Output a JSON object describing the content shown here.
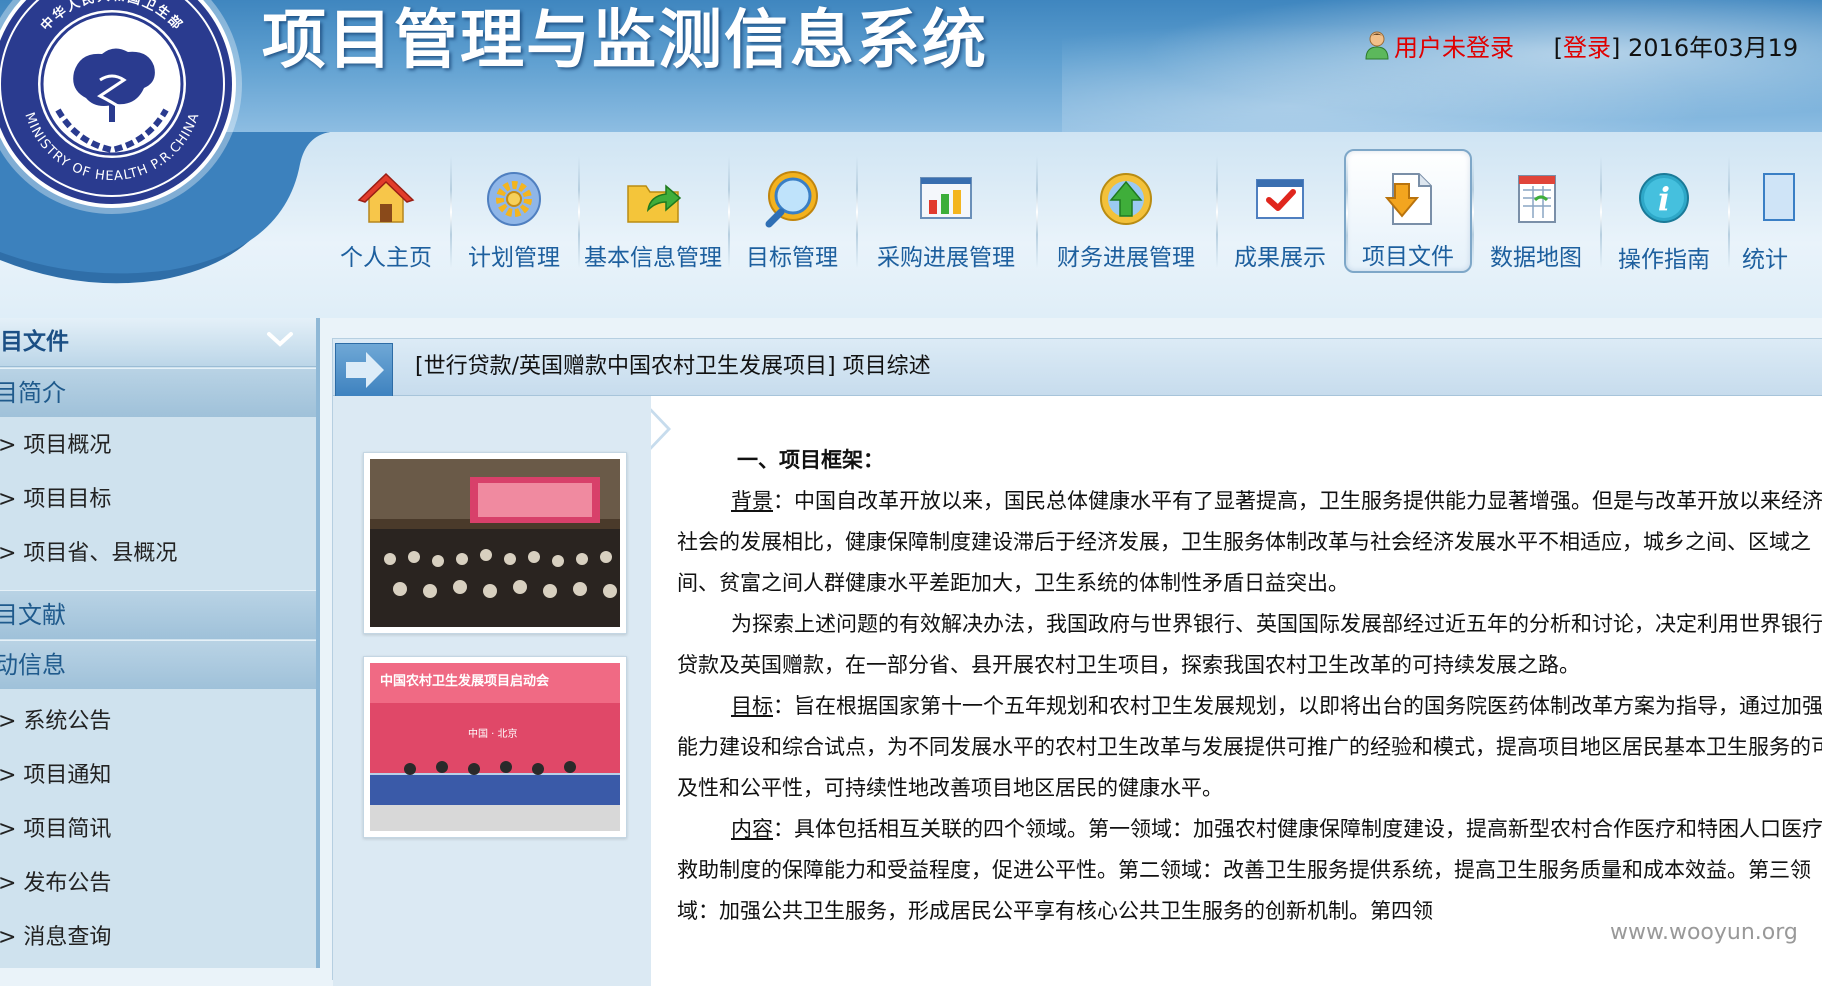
{
  "header": {
    "app_title": "项目管理与监测信息系统",
    "user_status": "用户未登录",
    "login_prefix": "[",
    "login_label": "登录",
    "login_suffix": "] 2016年03月19"
  },
  "logo": {
    "top_text": "中华人民共和国卫生部",
    "bottom_text": "MINISTRY OF HEALTH P.R.CHINA"
  },
  "nav": {
    "items": [
      {
        "label": "个人主页",
        "icon": "home-icon"
      },
      {
        "label": "计划管理",
        "icon": "gear-icon"
      },
      {
        "label": "基本信息管理",
        "icon": "folder-share-icon"
      },
      {
        "label": "目标管理",
        "icon": "magnifier-icon"
      },
      {
        "label": "采购进展管理",
        "icon": "bar-chart-icon"
      },
      {
        "label": "财务进展管理",
        "icon": "upload-globe-icon"
      },
      {
        "label": "成果展示",
        "icon": "checkmark-window-icon"
      },
      {
        "label": "项目文件",
        "icon": "document-download-icon",
        "active": true
      },
      {
        "label": "数据地图",
        "icon": "spreadsheet-icon"
      },
      {
        "label": "操作指南",
        "icon": "info-icon"
      },
      {
        "label": "统计",
        "icon": "statistics-icon"
      }
    ]
  },
  "sidebar": {
    "header": "目文件",
    "section1": "目简介",
    "section1_items": [
      "> 项目概况",
      "> 项目目标",
      "> 项目省、县概况"
    ],
    "section2": "目文献",
    "section3": "动信息",
    "section3_items": [
      "> 系统公告",
      "> 项目通知",
      "> 项目简讯",
      "> 发布公告",
      "> 消息查询"
    ]
  },
  "main": {
    "title": "[世行贷款/英国赠款中国农村卫生发展项目] 项目综述",
    "heading": "一、项目框架：",
    "p1_label": "背景",
    "p1_text": "：中国自改革开放以来，国民总体健康水平有了显著提高，卫生服务提供能力显著增强。但是与改革开放以来经济社会的发展相比，健康保障制度建设滞后于经济发展，卫生服务体制改革与社会经济发展水平不相适应，城乡之间、区域之间、贫富之间人群健康水平差距加大，卫生系统的体制性矛盾日益突出。",
    "p2_text": "为探索上述问题的有效解决办法，我国政府与世界银行、英国国际发展部经过近五年的分析和讨论，决定利用世界银行贷款及英国赠款，在一部分省、县开展农村卫生项目，探索我国农村卫生改革的可持续发展之路。",
    "p3_label": "目标",
    "p3_text": "：旨在根据国家第十一个五年规划和农村卫生发展规划，以即将出台的国务院医药体制改革方案为指导，通过加强能力建设和综合试点，为不同发展水平的农村卫生改革与发展提供可推广的经验和模式，提高项目地区居民基本卫生服务的可及性和公平性，可持续性地改善项目地区居民的健康水平。",
    "p4_label": "内容",
    "p4_text": "：具体包括相互关联的四个领域。第一领域：加强农村健康保障制度建设，提高新型农村合作医疗和特困人口医疗救助制度的保障能力和受益程度，促进公平性。第二领域：改善卫生服务提供系统，提高卫生服务质量和成本效益。第三领域：加强公共卫生服务，形成居民公平享有核心公共卫生服务的创新机制。第四领"
  },
  "photos": {
    "banner_text": "中国农村卫生发展项目启动会",
    "banner_sub": "中国 · 北京"
  },
  "watermark": "www.wooyun.org",
  "colors": {
    "header_blue": "#3f86bf",
    "nav_label": "#1d5f9e",
    "alert_red": "#e00000",
    "sidebar_bg": "#cfe2ee"
  }
}
